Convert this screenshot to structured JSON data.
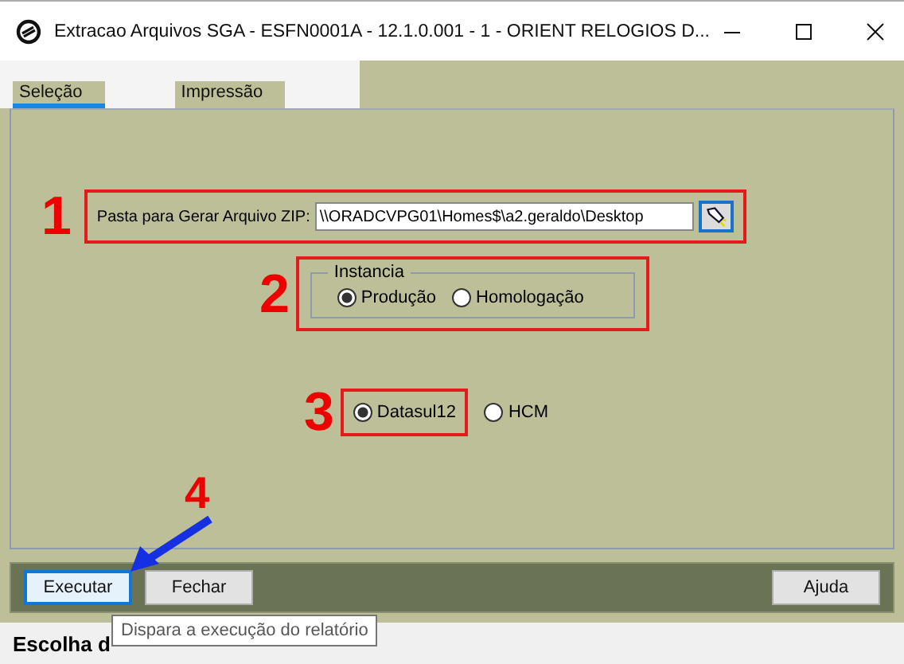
{
  "window": {
    "title": "Extracao Arquivos SGA - ESFN0001A - 12.1.0.001 - 1 - ORIENT RELOGIOS D..."
  },
  "tabs": [
    {
      "label": "Seleção",
      "selected": true
    },
    {
      "label": "Impressão",
      "selected": false
    }
  ],
  "folder_field": {
    "label": "Pasta para Gerar Arquivo ZIP:",
    "value": "\\\\ORADCVPG01\\Homes$\\a2.geraldo\\Desktop"
  },
  "instancia": {
    "title": "Instancia",
    "options": [
      {
        "label": "Produção",
        "selected": true
      },
      {
        "label": "Homologação",
        "selected": false
      }
    ]
  },
  "system_options": [
    {
      "label": "Datasul12",
      "selected": true
    },
    {
      "label": "HCM",
      "selected": false
    }
  ],
  "annotations": [
    "1",
    "2",
    "3",
    "4"
  ],
  "buttons": [
    {
      "label": "Executar",
      "focused": true
    },
    {
      "label": "Fechar",
      "focused": false
    },
    {
      "label": "Ajuda",
      "focused": false
    }
  ],
  "tooltip": "Dispara a execução do relatório",
  "status_bar": "Escolha d"
}
